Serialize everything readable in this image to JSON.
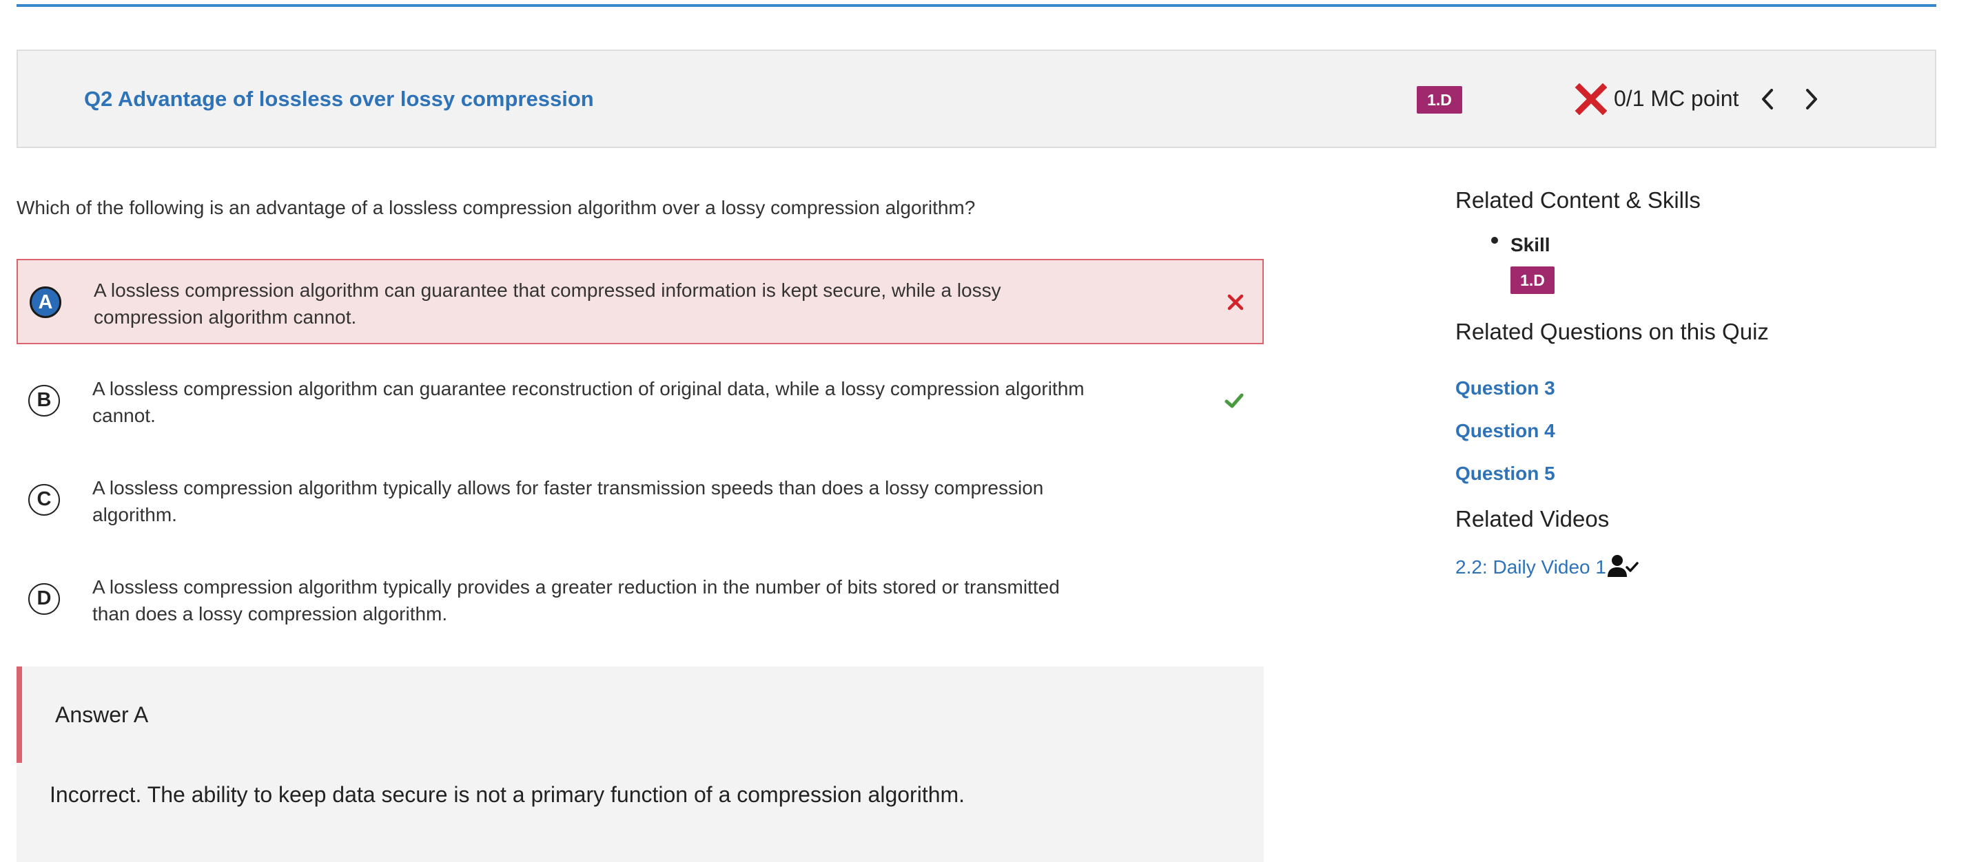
{
  "question": {
    "title": "Q2 Advantage of lossless over lossy compression",
    "skill_tag": "1.D",
    "score": "0/1 MC point",
    "status_icon": "x-mark-icon",
    "prompt": "Which of the following is an advantage of a lossless compression algorithm over a lossy compression algorithm?",
    "choices": [
      {
        "letter": "A",
        "text": "A lossless compression algorithm can guarantee that compressed information is kept secure, while a lossy compression algorithm cannot.",
        "state": "selected-incorrect"
      },
      {
        "letter": "B",
        "text": "A lossless compression algorithm can guarantee reconstruction of original data, while a lossy compression algorithm cannot.",
        "state": "correct"
      },
      {
        "letter": "C",
        "text": "A lossless compression algorithm typically allows for faster transmission speeds than does a lossy compression algorithm.",
        "state": "none"
      },
      {
        "letter": "D",
        "text": "A lossless compression algorithm typically provides a greater reduction in the number of bits stored or transmitted than does a lossy compression algorithm.",
        "state": "none"
      }
    ]
  },
  "feedback": {
    "title": "Answer A",
    "body": "Incorrect. The ability to keep data secure is not a primary function of a compression algorithm."
  },
  "sidebar": {
    "related_heading": "Related Content & Skills",
    "skill_label": "Skill",
    "skill_tag": "1.D",
    "questions_heading": "Related Questions on this Quiz",
    "questions": [
      "Question 3",
      "Question 4",
      "Question 5"
    ],
    "videos_heading": "Related Videos",
    "video_link": "2.2: Daily Video 1",
    "video_icon": "person-check-icon"
  },
  "colors": {
    "link": "#2e72b8",
    "skill_badge": "#a0296e",
    "incorrect": "#d9636f",
    "incorrect_mark": "#d2232a",
    "correct_mark": "#4a9a3f",
    "accent_rule": "#3a86cc"
  }
}
